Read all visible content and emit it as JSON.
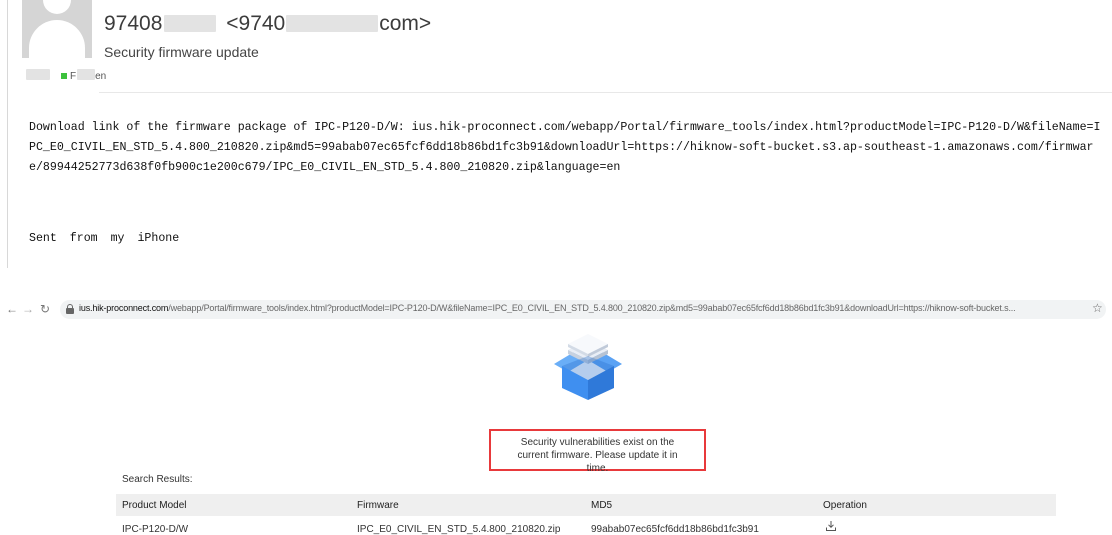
{
  "email": {
    "sender_prefix": "97408",
    "sender_email_prefix": "<9740",
    "sender_email_suffix": "com>",
    "subject": "Security firmware update",
    "recipient_suffix": "en",
    "recipient_initial": "F",
    "body_line": "Download link of the firmware package of IPC-P120-D/W: ius.hik-proconnect.com/webapp/Portal/firmware_tools/index.html?productModel=IPC-P120-D/W&fileName=IPC_E0_CIVIL_EN_STD_5.4.800_210820.zip&md5=99abab07ec65fcf6dd18b86bd1fc3b91&downloadUrl=https://hiknow-soft-bucket.s3.ap-southeast-1.amazonaws.com/firmware/89944252773d638f0fb900c1e200c679/IPC_E0_CIVIL_EN_STD_5.4.800_210820.zip&language=en",
    "signature": "Sent from my iPhone"
  },
  "browser": {
    "url_domain": "ius.hik-proconnect.com",
    "url_path": "/webapp/Portal/firmware_tools/index.html?productModel=IPC-P120-D/W&fileName=IPC_E0_CIVIL_EN_STD_5.4.800_210820.zip&md5=99abab07ec65fcf6dd18b86bd1fc3b91&downloadUrl=https://hiknow-soft-bucket.s...",
    "icons": {
      "back": "back-arrow-icon",
      "forward": "forward-arrow-icon",
      "reload": "reload-icon",
      "lock": "lock-icon",
      "star": "bookmark-star-icon",
      "package": "firmware-package-icon",
      "download": "download-icon"
    }
  },
  "page": {
    "warning": "Security vulnerabilities exist on the current firmware. Please update it in time.",
    "search_results_label": "Search Results:",
    "table": {
      "headers": [
        "Product Model",
        "Firmware",
        "MD5",
        "Operation"
      ],
      "rows": [
        [
          "IPC-P120-D/W",
          "IPC_E0_CIVIL_EN_STD_5.4.800_210820.zip",
          "99abab07ec65fcf6dd18b86bd1fc3b91"
        ]
      ]
    }
  },
  "colors": {
    "warning_border": "#e8393b",
    "recipient_status": "#3cc13c",
    "table_header_bg": "#efefef",
    "package_blue": "#3d8ef0"
  }
}
